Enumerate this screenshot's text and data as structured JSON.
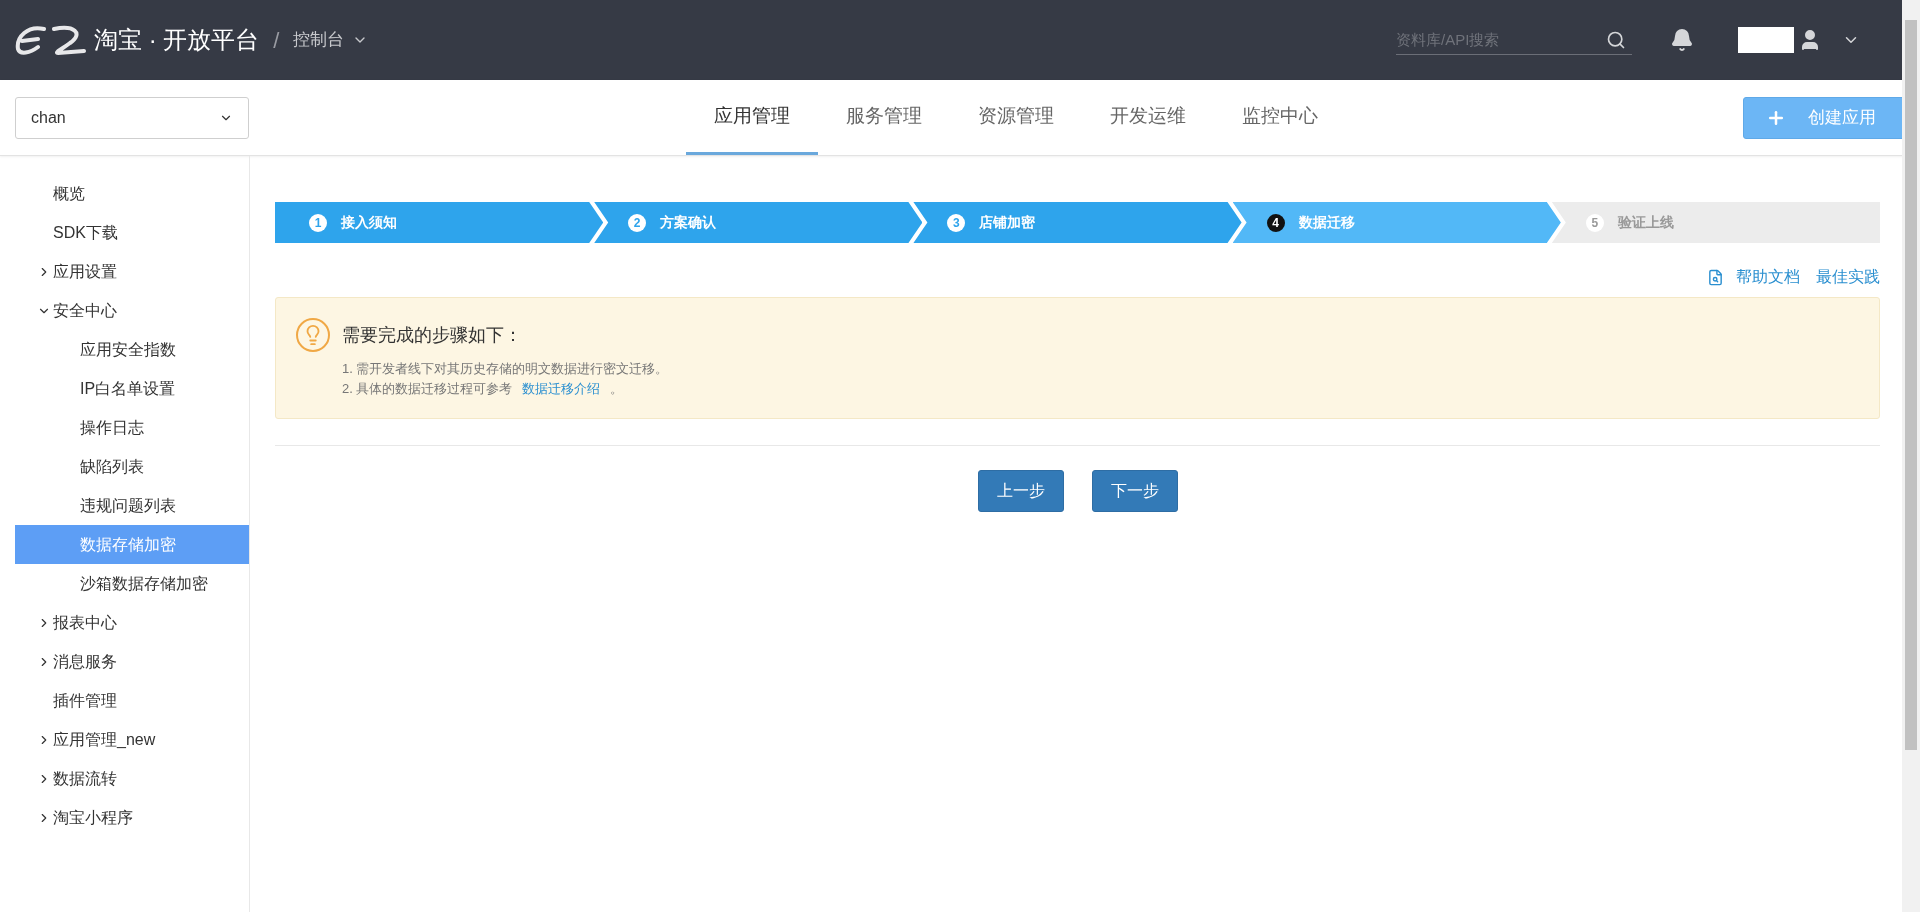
{
  "header": {
    "brand": "淘宝 · 开放平台",
    "separator": "/",
    "console": "控制台",
    "search": {
      "placeholder": "资料库/API搜索"
    }
  },
  "app_select": {
    "value": "chan"
  },
  "nav_tabs": [
    {
      "label": "应用管理",
      "selected": true
    },
    {
      "label": "服务管理",
      "selected": false
    },
    {
      "label": "资源管理",
      "selected": false
    },
    {
      "label": "开发运维",
      "selected": false
    },
    {
      "label": "监控中心",
      "selected": false
    }
  ],
  "create_button": {
    "label": "创建应用"
  },
  "sidebar": {
    "items": [
      {
        "label": "概览",
        "kind": "link",
        "selected": false
      },
      {
        "label": "SDK下载",
        "kind": "link",
        "selected": false
      },
      {
        "label": "应用设置",
        "kind": "group",
        "expanded": false,
        "selected": false
      },
      {
        "label": "安全中心",
        "kind": "group",
        "expanded": true,
        "selected": false,
        "children": [
          {
            "label": "应用安全指数",
            "selected": false
          },
          {
            "label": "IP白名单设置",
            "selected": false
          },
          {
            "label": "操作日志",
            "selected": false
          },
          {
            "label": "缺陷列表",
            "selected": false
          },
          {
            "label": "违规问题列表",
            "selected": false
          },
          {
            "label": "数据存储加密",
            "selected": true
          },
          {
            "label": "沙箱数据存储加密",
            "selected": false
          }
        ]
      },
      {
        "label": "报表中心",
        "kind": "group",
        "expanded": false,
        "selected": false
      },
      {
        "label": "消息服务",
        "kind": "group",
        "expanded": false,
        "selected": false
      },
      {
        "label": "插件管理",
        "kind": "link",
        "selected": false
      },
      {
        "label": "应用管理_new",
        "kind": "group",
        "expanded": false,
        "selected": false
      },
      {
        "label": "数据流转",
        "kind": "group",
        "expanded": false,
        "selected": false
      },
      {
        "label": "淘宝小程序",
        "kind": "group",
        "expanded": false,
        "selected": false
      }
    ]
  },
  "steps": [
    {
      "number": "1",
      "label": "接入须知",
      "done": true,
      "current": false
    },
    {
      "number": "2",
      "label": "方案确认",
      "done": true,
      "current": false
    },
    {
      "number": "3",
      "label": "店铺加密",
      "done": true,
      "current": false
    },
    {
      "number": "4",
      "label": "数据迁移",
      "done": false,
      "current": true
    },
    {
      "number": "5",
      "label": "验证上线",
      "done": false,
      "current": false
    }
  ],
  "help_links": [
    "帮助文档",
    "最佳实践"
  ],
  "notice": {
    "title": "需要完成的步骤如下：",
    "lines": [
      {
        "text": "1. 需开发者线下对其历史存储的明文数据进行密文迁移。"
      },
      {
        "text": "2. 具体的数据迁移过程可参考",
        "link": "数据迁移介绍",
        "after": "。"
      }
    ]
  },
  "buttons": [
    "上一步",
    "下一步"
  ]
}
